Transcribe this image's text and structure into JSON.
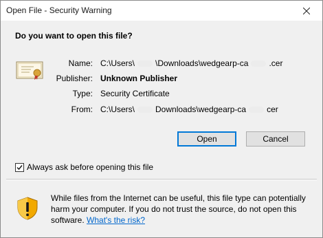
{
  "window": {
    "title": "Open File - Security Warning"
  },
  "dialog": {
    "heading": "Do you want to open this file?",
    "fields": {
      "name_label": "Name:",
      "name_value_start": "C:\\Users\\",
      "name_value_end": "\\Downloads\\wedgearp-ca",
      "name_value_ext": ".cer",
      "publisher_label": "Publisher:",
      "publisher_value": "Unknown Publisher",
      "type_label": "Type:",
      "type_value": "Security Certificate",
      "from_label": "From:",
      "from_value_start": "C:\\Users\\",
      "from_value_end": "Downloads\\wedgearp-ca",
      "from_value_ext": "cer"
    },
    "buttons": {
      "open": "Open",
      "cancel": "Cancel"
    },
    "checkbox": {
      "label": "Always ask before opening this file",
      "checked": true
    },
    "warning": {
      "text": "While files from the Internet can be useful, this file type can potentially harm your computer. If you do not trust the source, do not open this software.",
      "link": "What's the risk?"
    }
  },
  "colors": {
    "accent": "#0078d7",
    "link": "#0066cc",
    "window_bg": "#f0f0f0"
  },
  "icons": [
    "close-icon",
    "certificate-icon",
    "check-icon",
    "warning-shield-icon"
  ]
}
